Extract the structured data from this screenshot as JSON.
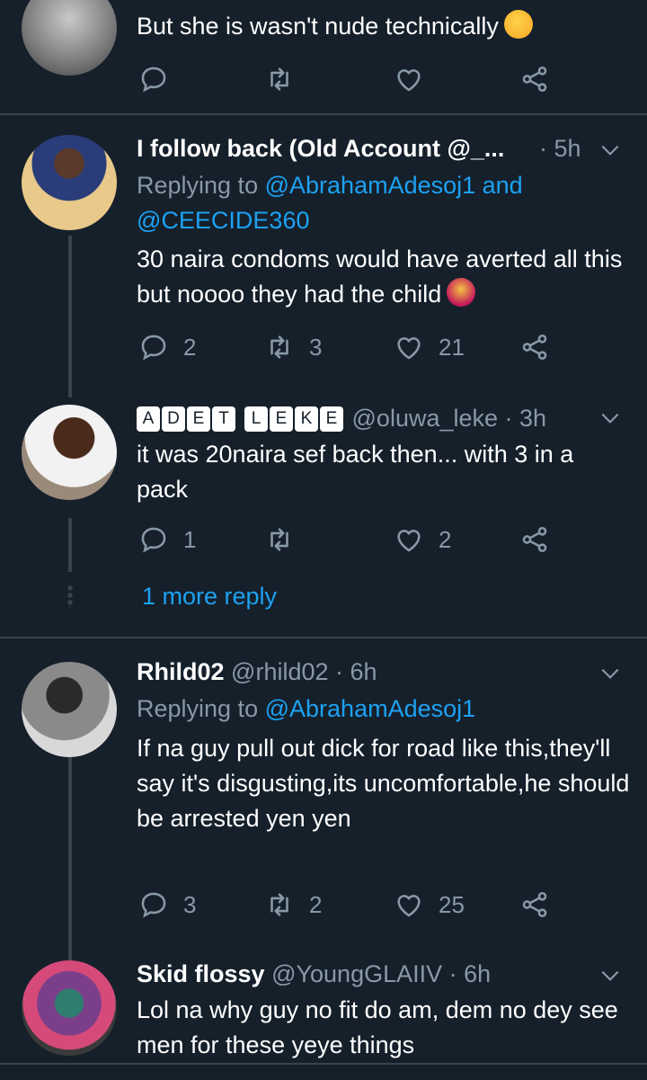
{
  "tweets": [
    {
      "text": "But she is wasn't nude technically",
      "emoji": "thinking-face-emoji",
      "actions": {
        "reply": "",
        "retweet": "",
        "like": ""
      }
    },
    {
      "name": "I follow back (Old Account @_...",
      "time": "· 5h",
      "replying_prefix": "Replying to",
      "replying_to": "@AbrahamAdesoj1 and",
      "replying_to2": "@CEECIDE360",
      "text": "30 naira condoms would have averted all this but noooo they had the child",
      "emoji": "facepalm-emoji",
      "actions": {
        "reply": "2",
        "retweet": "3",
        "like": "21"
      }
    },
    {
      "badges": [
        "A",
        "D",
        "E",
        "T",
        "L",
        "E",
        "K",
        "E"
      ],
      "handle": "@oluwa_leke",
      "time": "· 3h",
      "text": "it was 20naira sef back then... with 3 in a pack",
      "actions": {
        "reply": "1",
        "retweet": "",
        "like": "2"
      },
      "more_reply": "1 more reply"
    },
    {
      "name": "Rhild02",
      "handle": "@rhild02",
      "time": "· 6h",
      "replying_prefix": "Replying to",
      "replying_to": "@AbrahamAdesoj1",
      "text": "If na guy pull out dick for road like this,they'll say it's disgusting,its uncomfortable,he should be arrested yen yen",
      "actions": {
        "reply": "3",
        "retweet": "2",
        "like": "25"
      }
    },
    {
      "name": "Skid flossy",
      "handle": "@YoungGLAIIV",
      "time": "· 6h",
      "text": "Lol na why guy no fit do am, dem no dey see men for these yeye things"
    }
  ],
  "colors": {
    "background": "#15202b",
    "divider": "#38444d",
    "muted": "#8899a6",
    "link": "#1da1f2"
  }
}
